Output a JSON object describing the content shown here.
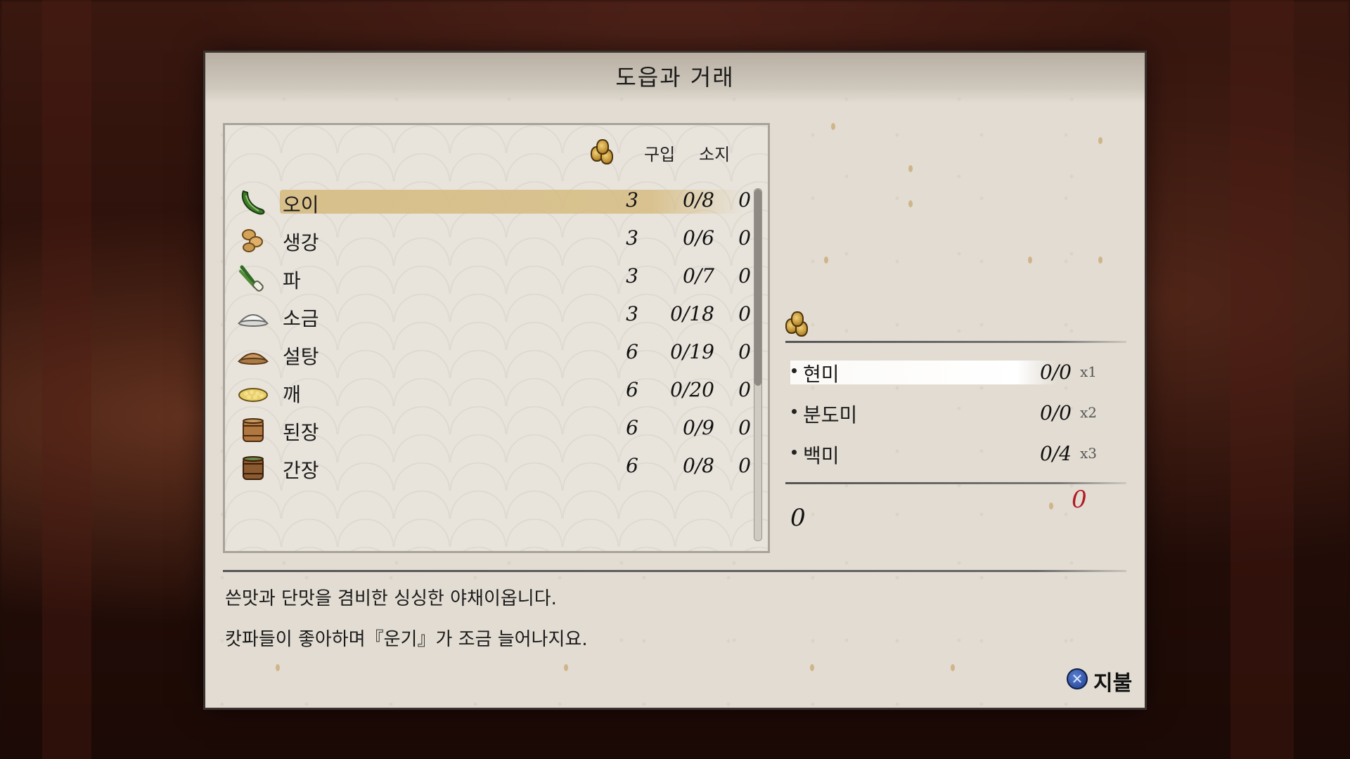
{
  "dialog": {
    "title": "도읍과 거래"
  },
  "list": {
    "col_price_icon": "coin-bag-icon",
    "col_buy": "구입",
    "col_own": "소지",
    "items": [
      {
        "name": "오이",
        "icon": "cucumber-icon",
        "price": "3",
        "buy": "0/8",
        "own": "0",
        "selected": true
      },
      {
        "name": "생강",
        "icon": "ginger-icon",
        "price": "3",
        "buy": "0/6",
        "own": "0"
      },
      {
        "name": "파",
        "icon": "leek-icon",
        "price": "3",
        "buy": "0/7",
        "own": "0"
      },
      {
        "name": "소금",
        "icon": "salt-icon",
        "price": "3",
        "buy": "0/18",
        "own": "0"
      },
      {
        "name": "설탕",
        "icon": "sugar-icon",
        "price": "6",
        "buy": "0/19",
        "own": "0"
      },
      {
        "name": "깨",
        "icon": "sesame-icon",
        "price": "6",
        "buy": "0/20",
        "own": "0"
      },
      {
        "name": "된장",
        "icon": "miso-barrel-icon",
        "price": "6",
        "buy": "0/9",
        "own": "0"
      },
      {
        "name": "간장",
        "icon": "soy-sauce-barrel-icon",
        "price": "6",
        "buy": "0/8",
        "own": "0"
      }
    ]
  },
  "currency": {
    "icon": "coin-bag-icon",
    "rice": [
      {
        "name": "현미",
        "count": "0/0",
        "mult": "x1",
        "selected": true
      },
      {
        "name": "분도미",
        "count": "0/0",
        "mult": "x2"
      },
      {
        "name": "백미",
        "count": "0/4",
        "mult": "x3"
      }
    ],
    "total_paid": "0",
    "total_cost": "0"
  },
  "description": {
    "line1": "쓴맛과 단맛을 겸비한 싱싱한 야채이옵니다.",
    "line2": "캇파들이 좋아하며『운기』가 조금 늘어나지요."
  },
  "controls": {
    "pay_button_glyph": "✕",
    "pay_label": "지불"
  },
  "colors": {
    "panel": "#e2dcd2",
    "highlight": "#d6bc82",
    "cost_red": "#b01b24"
  }
}
